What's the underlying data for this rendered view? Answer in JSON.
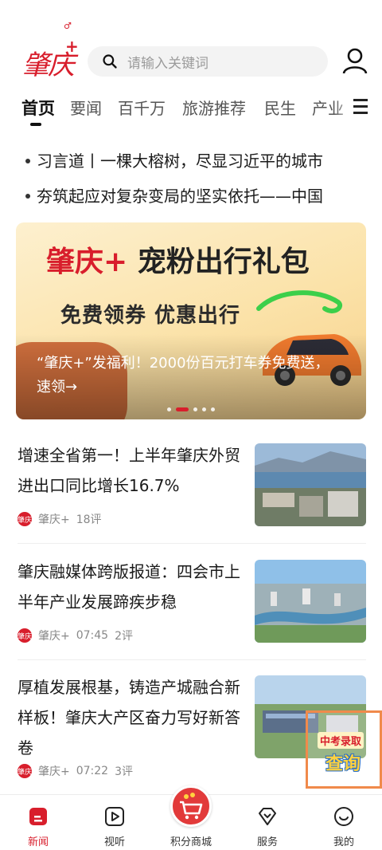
{
  "header": {
    "logo_text": "肇庆",
    "logo_plus": "+",
    "logo_mark": "♂",
    "search_placeholder": "请输入关键词"
  },
  "tabs": [
    {
      "label": "首页",
      "active": true
    },
    {
      "label": "要闻"
    },
    {
      "label": "百千万"
    },
    {
      "label": "旅游推荐"
    },
    {
      "label": "民生"
    },
    {
      "label": "产业"
    }
  ],
  "headlines": [
    "习言道丨一棵大榕树，尽显习近平的城市",
    "夯筑起应对复杂变局的坚实依托——中国"
  ],
  "banner": {
    "title_red": "肇庆+",
    "title_black": " 宠粉出行礼包",
    "subtitle": "免费领券 优惠出行",
    "caption": "“肇庆+”发福利！2000份百元打车券免费送，速领→"
  },
  "news": [
    {
      "title": "增速全省第一！上半年肇庆外贸进出口同比增长16.7%",
      "source": "肇庆+",
      "time": "",
      "comments": "18评"
    },
    {
      "title": "肇庆融媒体跨版报道：四会市上半年产业发展蹄疾步稳",
      "source": "肇庆+",
      "time": "07:45",
      "comments": "2评"
    },
    {
      "title": "厚植发展根基，铸造产城融合新样板！肇庆大产区奋力写好新答卷",
      "source": "肇庆+",
      "time": "07:22",
      "comments": "3评"
    }
  ],
  "source_logo_text": "肇庆",
  "float_badge": {
    "top": "中考录取",
    "bottom": "查询"
  },
  "bottom_nav": [
    {
      "label": "新闻",
      "active": true
    },
    {
      "label": "视听"
    },
    {
      "label": "积分商城"
    },
    {
      "label": "服务"
    },
    {
      "label": "我的"
    }
  ],
  "colors": {
    "accent": "#d81e2c",
    "badge_border": "#f08a4b"
  }
}
